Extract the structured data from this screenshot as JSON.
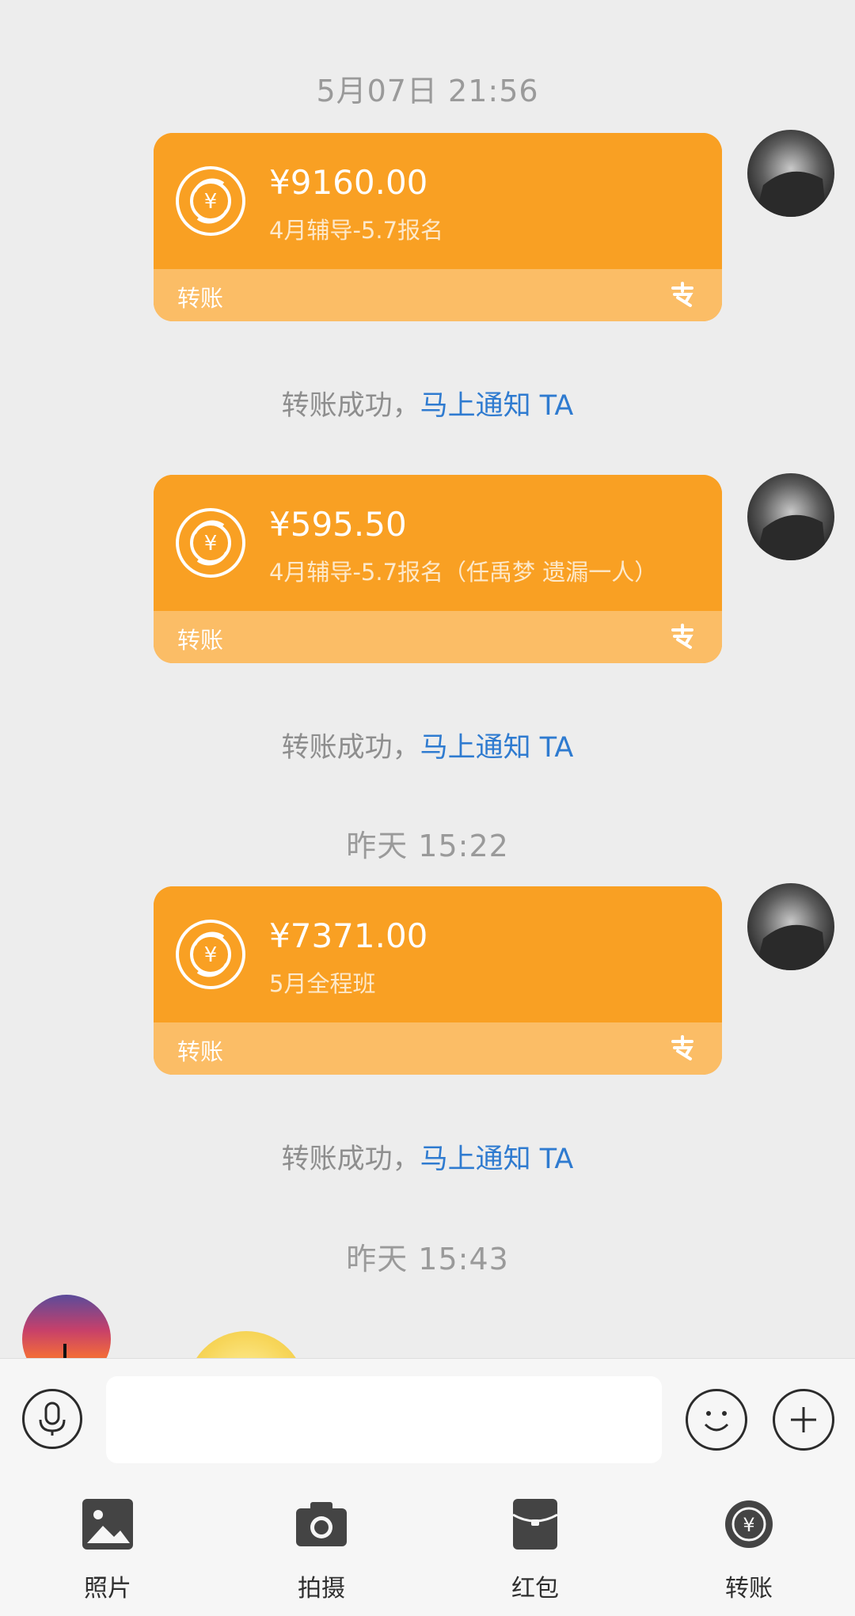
{
  "colors": {
    "background": "#ededed",
    "card_orange": "#f9a023",
    "card_footer": "#fbbd66",
    "link_blue": "#2f7bd0",
    "timestamp_gray": "#9a9a9a"
  },
  "conversation": {
    "timestamps": [
      "5月07日 21:56",
      "昨天 15:22",
      "昨天 15:43"
    ],
    "transfers": [
      {
        "amount": "¥9160.00",
        "memo": "4月辅导-5.7报名",
        "type_label": "转账",
        "icon": "transfer-coin-icon",
        "logo": "alipay-logo-icon"
      },
      {
        "amount": "¥595.50",
        "memo": "4月辅导-5.7报名（任禹梦  遗漏一人）",
        "type_label": "转账",
        "icon": "transfer-coin-icon",
        "logo": "alipay-logo-icon"
      },
      {
        "amount": "¥7371.00",
        "memo": "5月全程班",
        "type_label": "转账",
        "icon": "transfer-coin-icon",
        "logo": "alipay-logo-icon"
      }
    ],
    "notices": [
      {
        "text": "转账成功，",
        "link": "马上通知 TA"
      },
      {
        "text": "转账成功，",
        "link": "马上通知 TA"
      },
      {
        "text": "转账成功，",
        "link": "马上通知 TA"
      }
    ]
  },
  "input_bar": {
    "placeholder": "",
    "voice_icon": "microphone-icon",
    "emoji_icon": "smiley-icon",
    "plus_icon": "plus-icon"
  },
  "tools": [
    {
      "label": "照片",
      "icon": "photo-icon"
    },
    {
      "label": "拍摄",
      "icon": "camera-icon"
    },
    {
      "label": "红包",
      "icon": "red-envelope-icon"
    },
    {
      "label": "转账",
      "icon": "transfer-icon"
    }
  ]
}
